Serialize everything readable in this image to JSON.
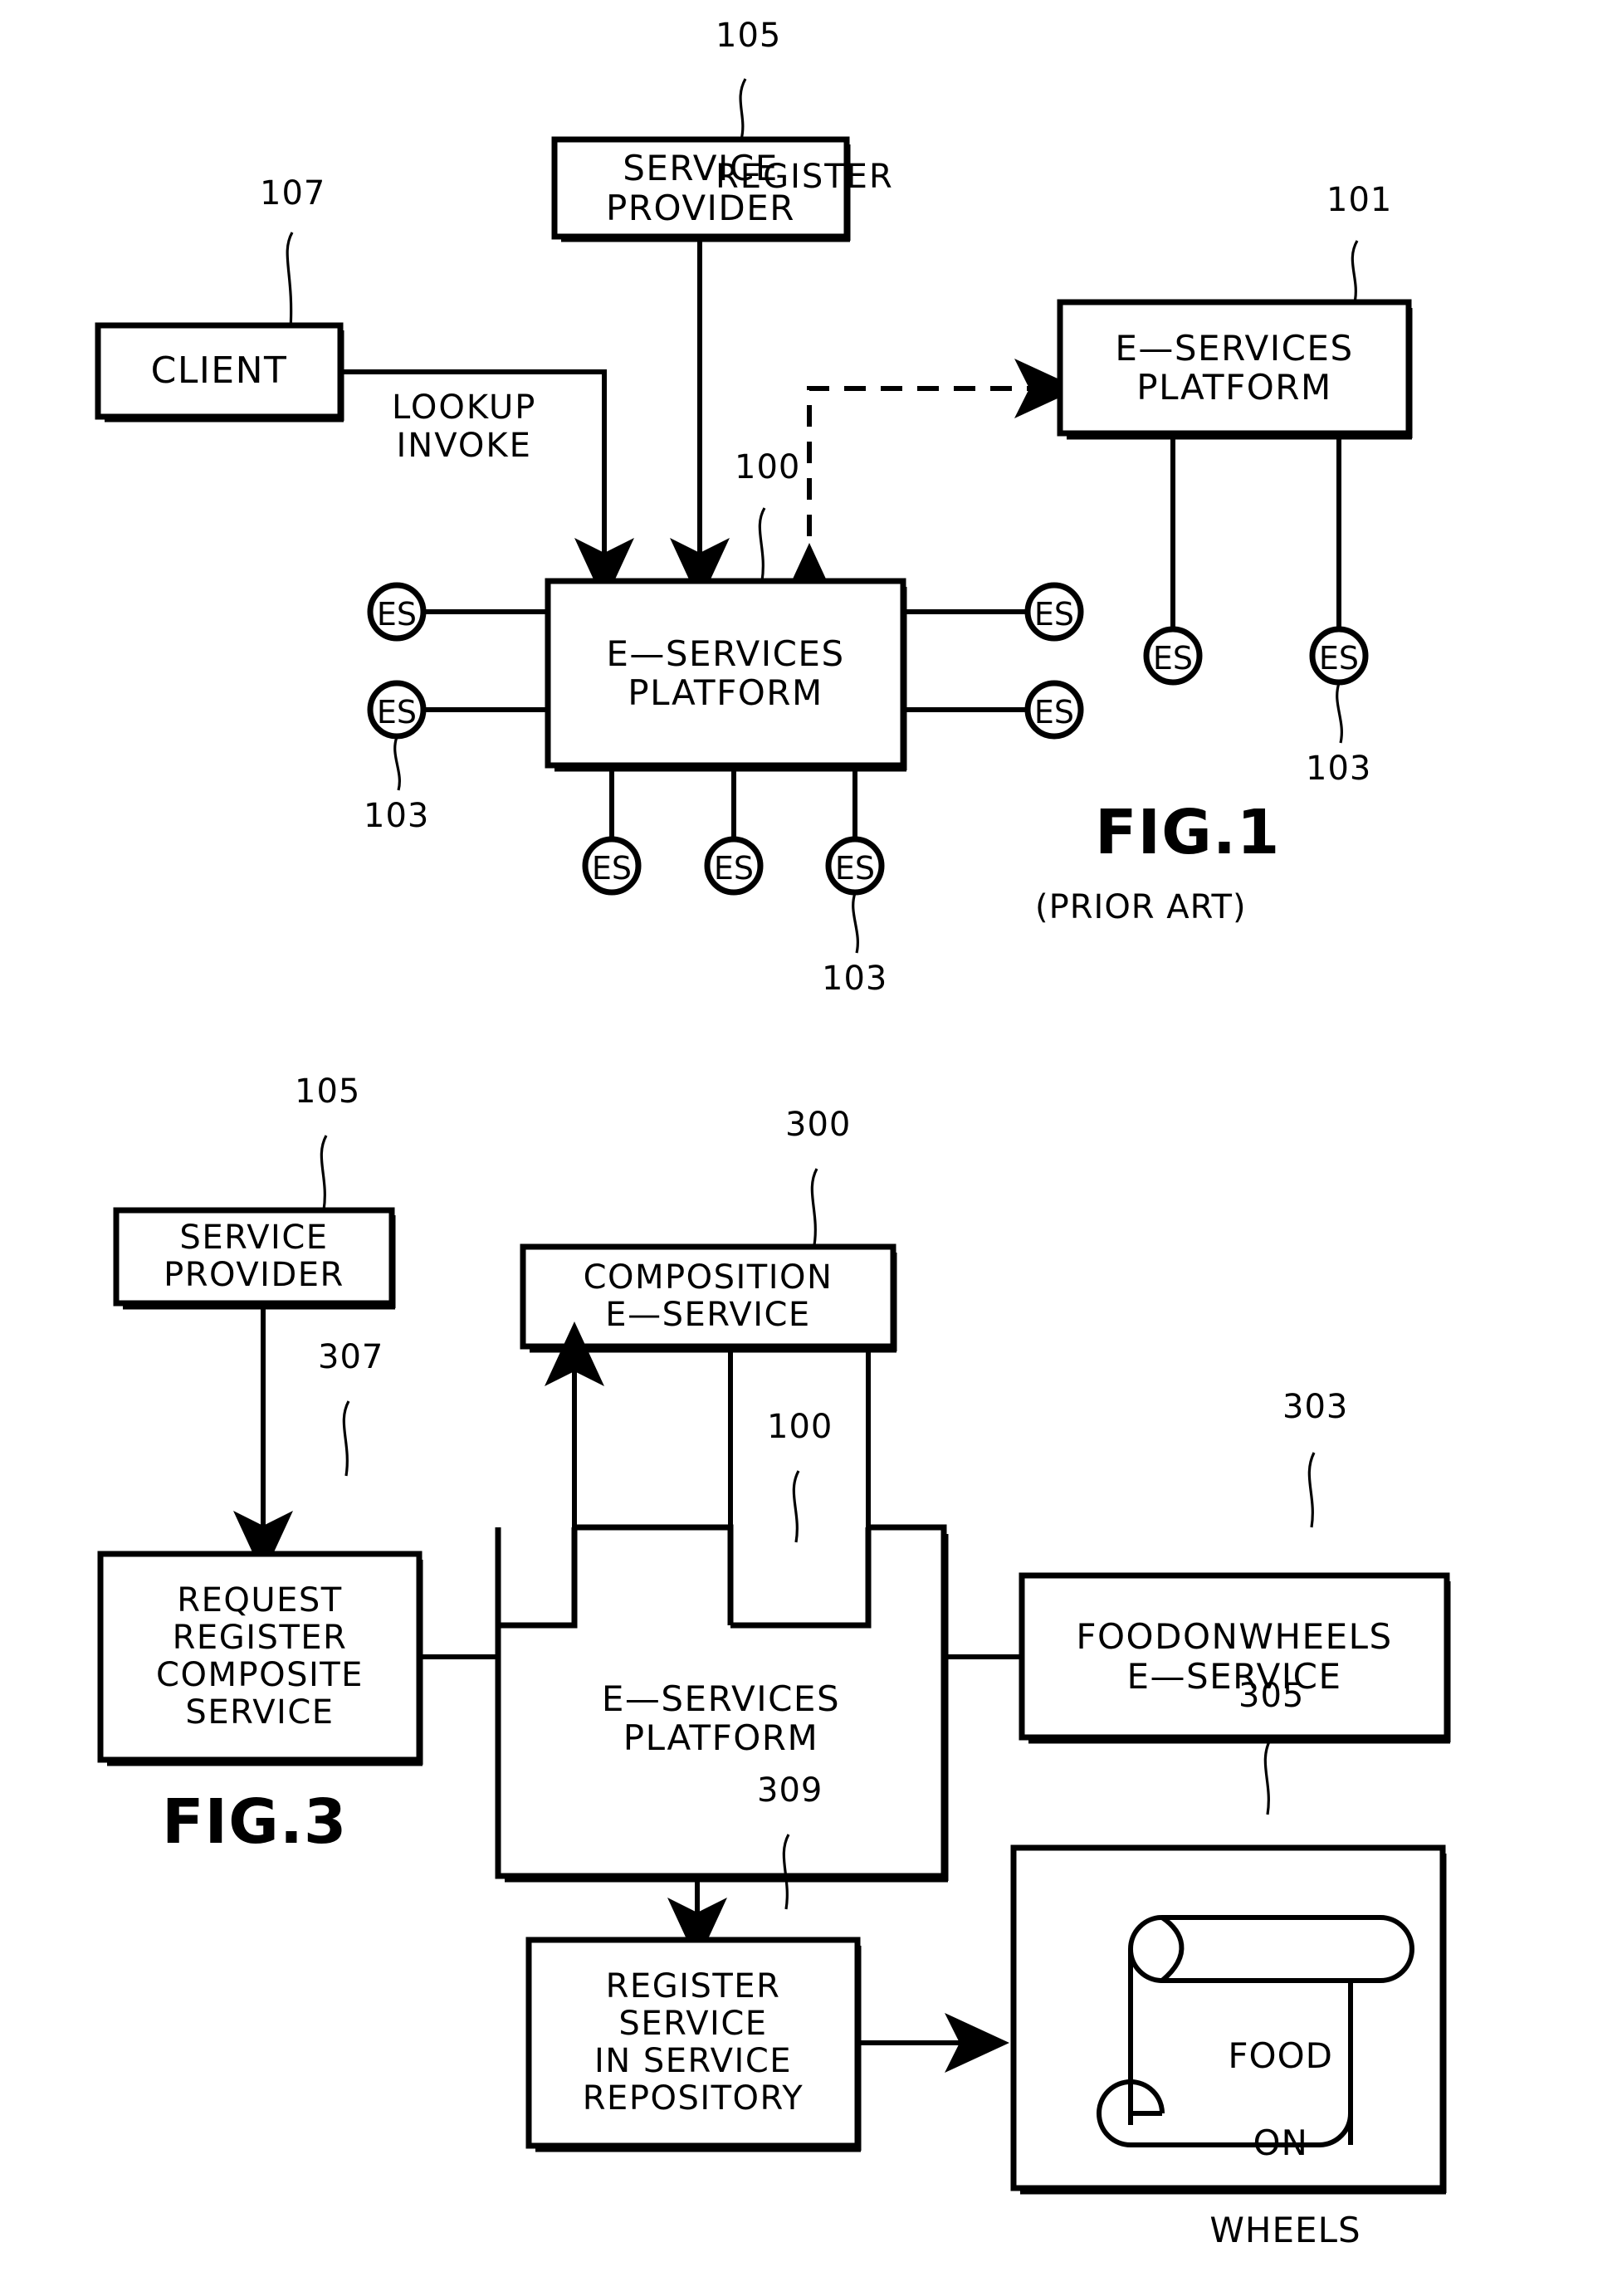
{
  "document": {
    "type": "patent-drawing-sheet",
    "figures": [
      "FIG.1",
      "FIG.3"
    ]
  },
  "fig1": {
    "caption": "FIG.1",
    "subcaption": "(PRIOR ART)",
    "boxes": {
      "service_provider": {
        "lines": [
          "SERVICE",
          "PROVIDER"
        ],
        "ref": "105"
      },
      "client": {
        "lines": [
          "CLIENT"
        ],
        "ref": "107"
      },
      "platform_main": {
        "lines": [
          "E—SERVICES",
          "PLATFORM"
        ],
        "ref": "100"
      },
      "platform_right": {
        "lines": [
          "E—SERVICES",
          "PLATFORM"
        ],
        "ref": "101"
      }
    },
    "edge_labels": {
      "register": "REGISTER",
      "lookup_invoke": "LOOKUP\nINVOKE"
    },
    "es_node_label": "ES",
    "es_refs": [
      "103",
      "103",
      "103"
    ],
    "es_main_left": [
      "ES",
      "ES"
    ],
    "es_main_right": [
      "ES",
      "ES"
    ],
    "es_main_bottom": [
      "ES",
      "ES",
      "ES"
    ],
    "es_right_platform": [
      "ES",
      "ES"
    ]
  },
  "fig3": {
    "caption": "FIG.3",
    "boxes": {
      "service_provider": {
        "lines": [
          "SERVICE",
          "PROVIDER"
        ],
        "ref": "105"
      },
      "request_register": {
        "lines": [
          "REQUEST",
          "REGISTER",
          "COMPOSITE",
          "SERVICE"
        ],
        "ref": "307"
      },
      "composition": {
        "lines": [
          "COMPOSITION",
          "E—SERVICE"
        ],
        "ref": "300"
      },
      "platform": {
        "lines": [
          "E—SERVICES",
          "PLATFORM"
        ],
        "ref": "100"
      },
      "foodonwheels": {
        "lines": [
          "FOODONWHEELS",
          "E—SERVICE"
        ],
        "ref": "303"
      },
      "register_repo": {
        "lines": [
          "REGISTER",
          "SERVICE",
          "IN SERVICE",
          "REPOSITORY"
        ],
        "ref": "309"
      },
      "scroll": {
        "lines": [
          "FOOD",
          "ON",
          "WHEELS"
        ],
        "ref": "305"
      }
    }
  },
  "style": {
    "ink": "#000000",
    "paper": "#ffffff"
  }
}
